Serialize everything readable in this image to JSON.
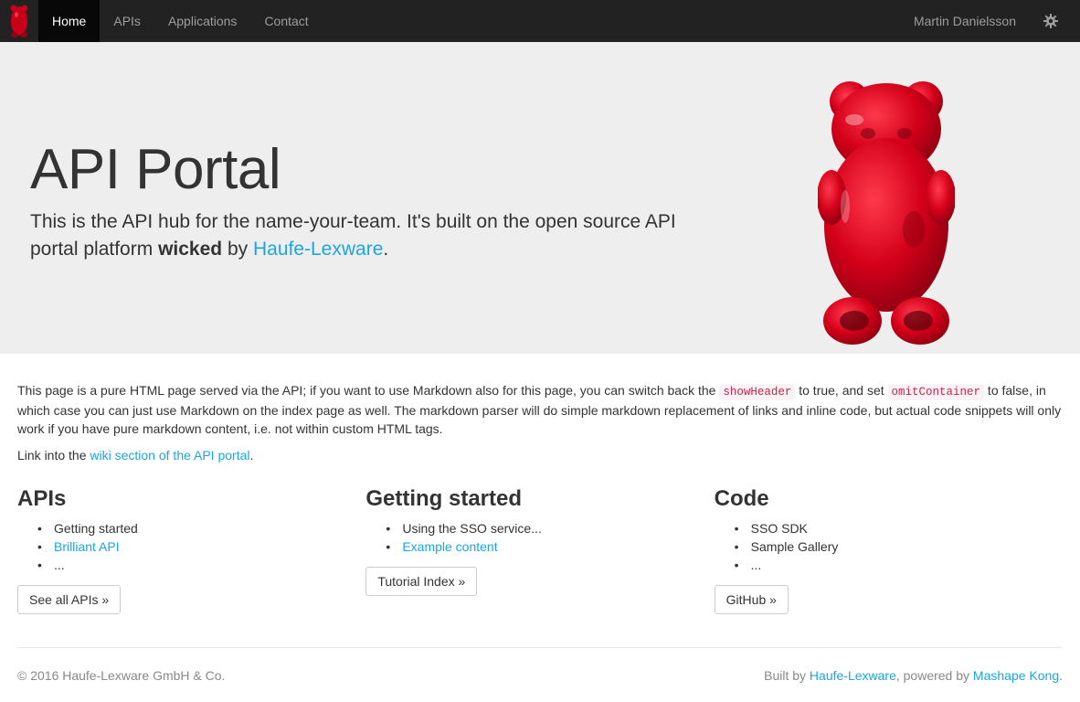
{
  "navbar": {
    "items": [
      {
        "label": "Home"
      },
      {
        "label": "APIs"
      },
      {
        "label": "Applications"
      },
      {
        "label": "Contact"
      }
    ],
    "user": "Martin Danielsson",
    "settings_icon": "gear-icon",
    "logo_icon": "gummy-bear-logo"
  },
  "jumbotron": {
    "title": "API Portal",
    "lead_1": "This is the API hub for the name-your-team. It's built on the open source API portal platform ",
    "lead_bold": "wicked",
    "lead_2": " by ",
    "lead_link": "Haufe-Lexware",
    "lead_3": "."
  },
  "intro": {
    "p1_a": "This page is a pure HTML page served via the API; if you want to use Markdown also for this page, you can switch back the ",
    "code1": "showHeader",
    "p1_b": " to true, and set ",
    "code2": "omitContainer",
    "p1_c": " to false, in which case you can just use Markdown on the index page as well. The markdown parser will do simple markdown replacement of links and inline code, but actual code snippets will only work if you have pure markdown content, i.e. not within custom HTML tags.",
    "p2_a": "Link into the ",
    "p2_link": "wiki section of the API portal",
    "p2_b": "."
  },
  "columns": [
    {
      "title": "APIs",
      "items": [
        {
          "text": "Getting started",
          "link": false
        },
        {
          "text": "Brilliant API",
          "link": true
        },
        {
          "text": "...",
          "link": false
        }
      ],
      "button": "See all APIs »"
    },
    {
      "title": "Getting started",
      "items": [
        {
          "text": "Using the SSO service...",
          "link": false
        },
        {
          "text": "Example content",
          "link": true
        }
      ],
      "button": "Tutorial Index »"
    },
    {
      "title": "Code",
      "items": [
        {
          "text": "SSO SDK",
          "link": false
        },
        {
          "text": "Sample Gallery",
          "link": false
        },
        {
          "text": "...",
          "link": false
        }
      ],
      "button": "GitHub »"
    }
  ],
  "footer": {
    "copyright": "© 2016 Haufe-Lexware GmbH & Co.",
    "built_by": "Built by ",
    "built_link": "Haufe-Lexware",
    "powered_by": ", powered by ",
    "powered_link": "Mashape Kong",
    "end": "."
  },
  "colors": {
    "navbar": "#222222",
    "jumbotron": "#eeeeee",
    "link": "#1aa6e0",
    "bear": "#d0021b"
  }
}
